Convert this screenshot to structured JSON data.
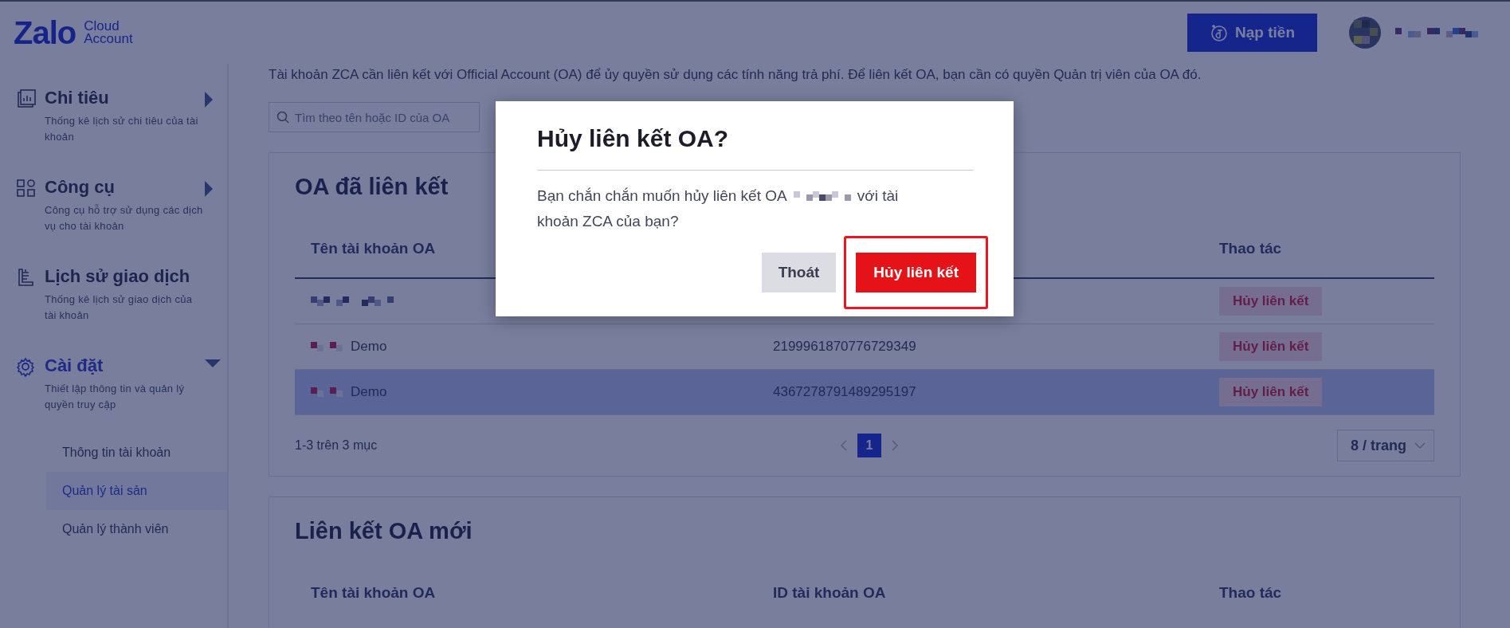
{
  "header": {
    "logo": "Zalo",
    "logo_sub": "Cloud Account",
    "topup_button": "Nạp tiền"
  },
  "sidebar": {
    "items": [
      {
        "kind": "chart",
        "title": "Chi tiêu",
        "description": "Thống kê lịch sử chi tiêu của tài khoản",
        "expanded": false
      },
      {
        "kind": "tools",
        "title": "Công cụ",
        "description": "Công cụ hỗ trợ sử dụng các dịch vụ cho tài khoản",
        "expanded": false
      },
      {
        "kind": "receipt",
        "title": "Lịch sử giao dịch",
        "description": "Thống kê lịch sử giao dịch của tài khoản"
      },
      {
        "kind": "settings",
        "title": "Cài đặt",
        "description": "Thiết lập thông tin và quản lý quyền truy cập",
        "expanded": true,
        "children": [
          {
            "label": "Thông tin tài khoản",
            "selected": false
          },
          {
            "label": "Quản lý tài sản",
            "selected": true
          },
          {
            "label": "Quản lý thành viên",
            "selected": false
          }
        ]
      }
    ]
  },
  "content": {
    "intro": "Tài khoản ZCA cần liên kết với Official Account (OA) để ủy quyền sử dụng các tính năng trả phí. Để liên kết OA, bạn cần có quyền Quản trị viên của OA đó.",
    "search": {
      "placeholder": "Tìm theo tên hoặc ID của OA"
    },
    "linked_card": {
      "title": "OA đã liên kết",
      "columns": [
        "Tên tài khoản OA",
        "Thao tác"
      ],
      "rows": [
        {
          "action": "Hủy liên kết",
          "selected": false
        },
        {
          "name": "Demo",
          "id": "2199961870776729349",
          "action": "Hủy liên kết",
          "selected": false
        },
        {
          "name": "Demo",
          "id": "4367278791489295197",
          "action": "Hủy liên kết",
          "selected": true
        }
      ],
      "pagination": {
        "summary": "1-3 trên 3 mục",
        "pages": [
          {
            "label": "1",
            "selected": true
          }
        ],
        "page_size": "8 / trang"
      }
    },
    "new_card": {
      "title": "Liên kết OA mới",
      "columns": [
        "Tên tài khoản OA",
        "ID tài khoản OA",
        "Thao tác"
      ]
    }
  },
  "modal": {
    "title": "Hủy liên kết OA?",
    "message_before": "Bạn chắn chắn muốn hủy liên kết OA",
    "message_after": "với tài",
    "message_line2": "khoản ZCA của bạn?",
    "cancel_button": "Thoát",
    "confirm_button": "Hủy liên kết",
    "confirm_highlighted": true
  }
}
